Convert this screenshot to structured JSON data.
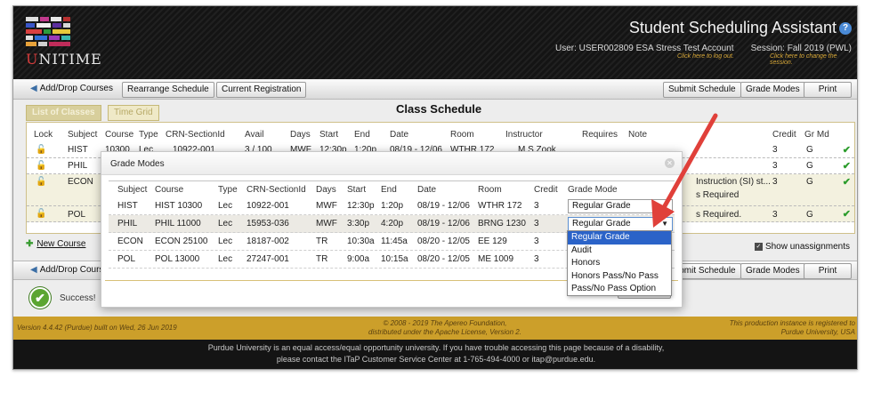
{
  "header": {
    "logo_text_u": "U",
    "logo_text_rest": "NITIME",
    "app_title": "Student Scheduling Assistant",
    "help_glyph": "?",
    "user_label": "User: USER002809 ESA Stress Test Account",
    "user_hint": "Click here to log out.",
    "session_label": "Session: Fall 2019 (PWL)",
    "session_hint": "Click here to change the session."
  },
  "toolbar": {
    "add_drop": "Add/Drop Courses",
    "rearrange": "Rearrange Schedule",
    "current_registration": "Current Registration",
    "submit": "Submit Schedule",
    "grade_modes": "Grade Modes",
    "print": "Print"
  },
  "tabs": [
    {
      "label": "List of Classes",
      "active": true
    },
    {
      "label": "Time Grid",
      "active": false
    }
  ],
  "schedule": {
    "title": "Class Schedule",
    "columns": [
      "Lock",
      "Subject",
      "Course",
      "Type",
      "CRN-SectionId",
      "Avail",
      "Days",
      "Start",
      "End",
      "Date",
      "Room",
      "Instructor",
      "Requires",
      "Note",
      "Credit",
      "Gr Md"
    ],
    "rows": [
      {
        "subject": "HIST",
        "course": "10300",
        "type": "Lec",
        "crn": "10922-001",
        "avail": "3 / 100",
        "days": "MWF",
        "start": "12:30p",
        "end": "1:20p",
        "date": "08/19 - 12/06",
        "room": "WTHR 172",
        "instructor": "M S Zook",
        "note": "",
        "credit": "3",
        "grmd": "G"
      },
      {
        "subject": "PHIL",
        "credit": "3",
        "grmd": "G",
        "note": ""
      },
      {
        "subject": "ECON",
        "note": "Instruction (SI) st...",
        "note2": "s Required",
        "credit": "3",
        "grmd": "G"
      },
      {
        "subject": "POL",
        "note": "s Required.",
        "credit": "3",
        "grmd": "G"
      }
    ],
    "new_course": "New Course",
    "show_unassignments": "Show unassignments"
  },
  "status": {
    "success": "Success!"
  },
  "footer": {
    "version": "Version 4.4.42 (Purdue) built on Wed, 26 Jun 2019",
    "copyright_1": "© 2008 - 2019 The Apereo Foundation,",
    "copyright_2": "distributed under the Apache License, Version 2.",
    "instance_1": "This production instance is registered to",
    "instance_2": "Purdue University, USA",
    "notice_1": "Purdue University is an equal access/equal opportunity university. If you have trouble accessing this page because of a disability,",
    "notice_2": "please contact the ITaP Customer Service Center at 1-765-494-4000 or itap@purdue.edu."
  },
  "modal": {
    "title": "Grade Modes",
    "columns": [
      "Subject",
      "Course",
      "Type",
      "CRN-SectionId",
      "Days",
      "Start",
      "End",
      "Date",
      "Room",
      "Credit",
      "Grade Mode"
    ],
    "rows": [
      {
        "subject": "HIST",
        "course": "HIST 10300",
        "type": "Lec",
        "crn": "10922-001",
        "days": "MWF",
        "start": "12:30p",
        "end": "1:20p",
        "date": "08/19 - 12/06",
        "room": "WTHR 172",
        "credit": "3",
        "grade_mode": "Regular Grade"
      },
      {
        "subject": "PHIL",
        "course": "PHIL 11000",
        "type": "Lec",
        "crn": "15953-036",
        "days": "MWF",
        "start": "3:30p",
        "end": "4:20p",
        "date": "08/19 - 12/06",
        "room": "BRNG 1230",
        "credit": "3",
        "grade_mode": "Regular Grade"
      },
      {
        "subject": "ECON",
        "course": "ECON 25100",
        "type": "Lec",
        "crn": "18187-002",
        "days": "TR",
        "start": "10:30a",
        "end": "11:45a",
        "date": "08/20 - 12/05",
        "room": "EE 129",
        "credit": "3",
        "grade_mode": ""
      },
      {
        "subject": "POL",
        "course": "POL 13000",
        "type": "Lec",
        "crn": "27247-001",
        "days": "TR",
        "start": "9:00a",
        "end": "10:15a",
        "date": "08/20 - 12/05",
        "room": "ME 1009",
        "credit": "3",
        "grade_mode": ""
      }
    ],
    "dropdown_options": [
      "Regular Grade",
      "Audit",
      "Honors",
      "Honors Pass/No Pass",
      "Pass/No Pass Option"
    ],
    "selected_option": "Regular Grade"
  },
  "colors": {
    "annotation_arrow": "#e0403a",
    "footer_gold": "#cc9f2a",
    "dropdown_highlight": "#2b63c8",
    "success_green": "#5ba531"
  }
}
